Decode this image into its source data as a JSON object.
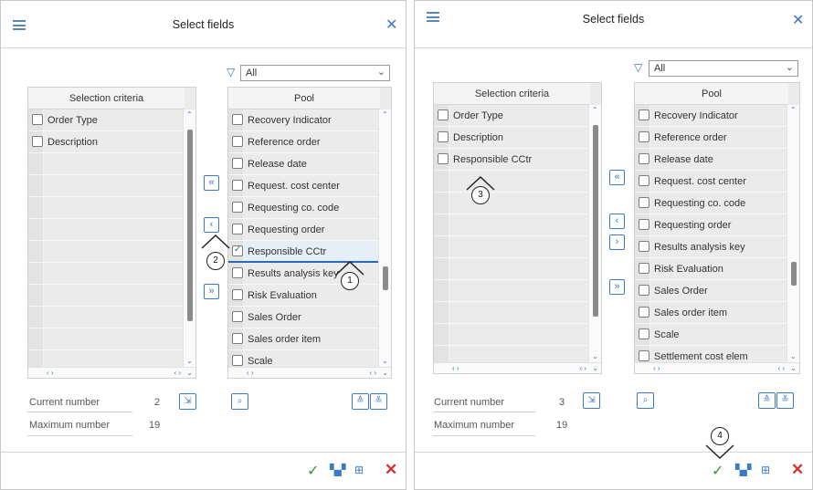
{
  "dialogs": [
    {
      "title": "Select fields",
      "filter_value": "All",
      "selection_header": "Selection criteria",
      "selection_items": [
        "Order Type",
        "Description"
      ],
      "pool_header": "Pool",
      "pool_items": [
        "Recovery Indicator",
        "Reference order",
        "Release date",
        "Request. cost center",
        "Requesting co. code",
        "Requesting order",
        "Responsible CCtr",
        "Results analysis key",
        "Risk Evaluation",
        "Sales Order",
        "Sales order item",
        "Scale"
      ],
      "pool_checked_index": 6,
      "current_number_label": "Current number",
      "current_number": "2",
      "maximum_number_label": "Maximum number",
      "maximum_number": "19",
      "markers": [
        "1",
        "2"
      ]
    },
    {
      "title": "Select fields",
      "filter_value": "All",
      "selection_header": "Selection criteria",
      "selection_items": [
        "Order Type",
        "Description",
        "Responsible CCtr"
      ],
      "pool_header": "Pool",
      "pool_items": [
        "Recovery Indicator",
        "Reference order",
        "Release date",
        "Request. cost center",
        "Requesting co. code",
        "Requesting order",
        "Results analysis key",
        "Risk Evaluation",
        "Sales Order",
        "Sales order item",
        "Scale",
        "Settlement cost elem"
      ],
      "pool_checked_index": -1,
      "current_number_label": "Current number",
      "current_number": "3",
      "maximum_number_label": "Maximum number",
      "maximum_number": "19",
      "markers": [
        "3",
        "4"
      ]
    }
  ],
  "icons": {
    "menu": "hamburger-icon",
    "close": "close-icon",
    "filter": "filter-icon",
    "move_all_left": "double-chevron-left-icon",
    "move_left": "chevron-left-icon",
    "move_right": "chevron-right-icon",
    "move_all_right": "double-chevron-right-icon",
    "confirm": "checkmark-icon",
    "delete": "delete-icon"
  },
  "colors": {
    "accent": "#3b7ac6",
    "confirm": "#2e9a3a",
    "cancel": "#d33131",
    "highlight": "#2a6ab5"
  }
}
